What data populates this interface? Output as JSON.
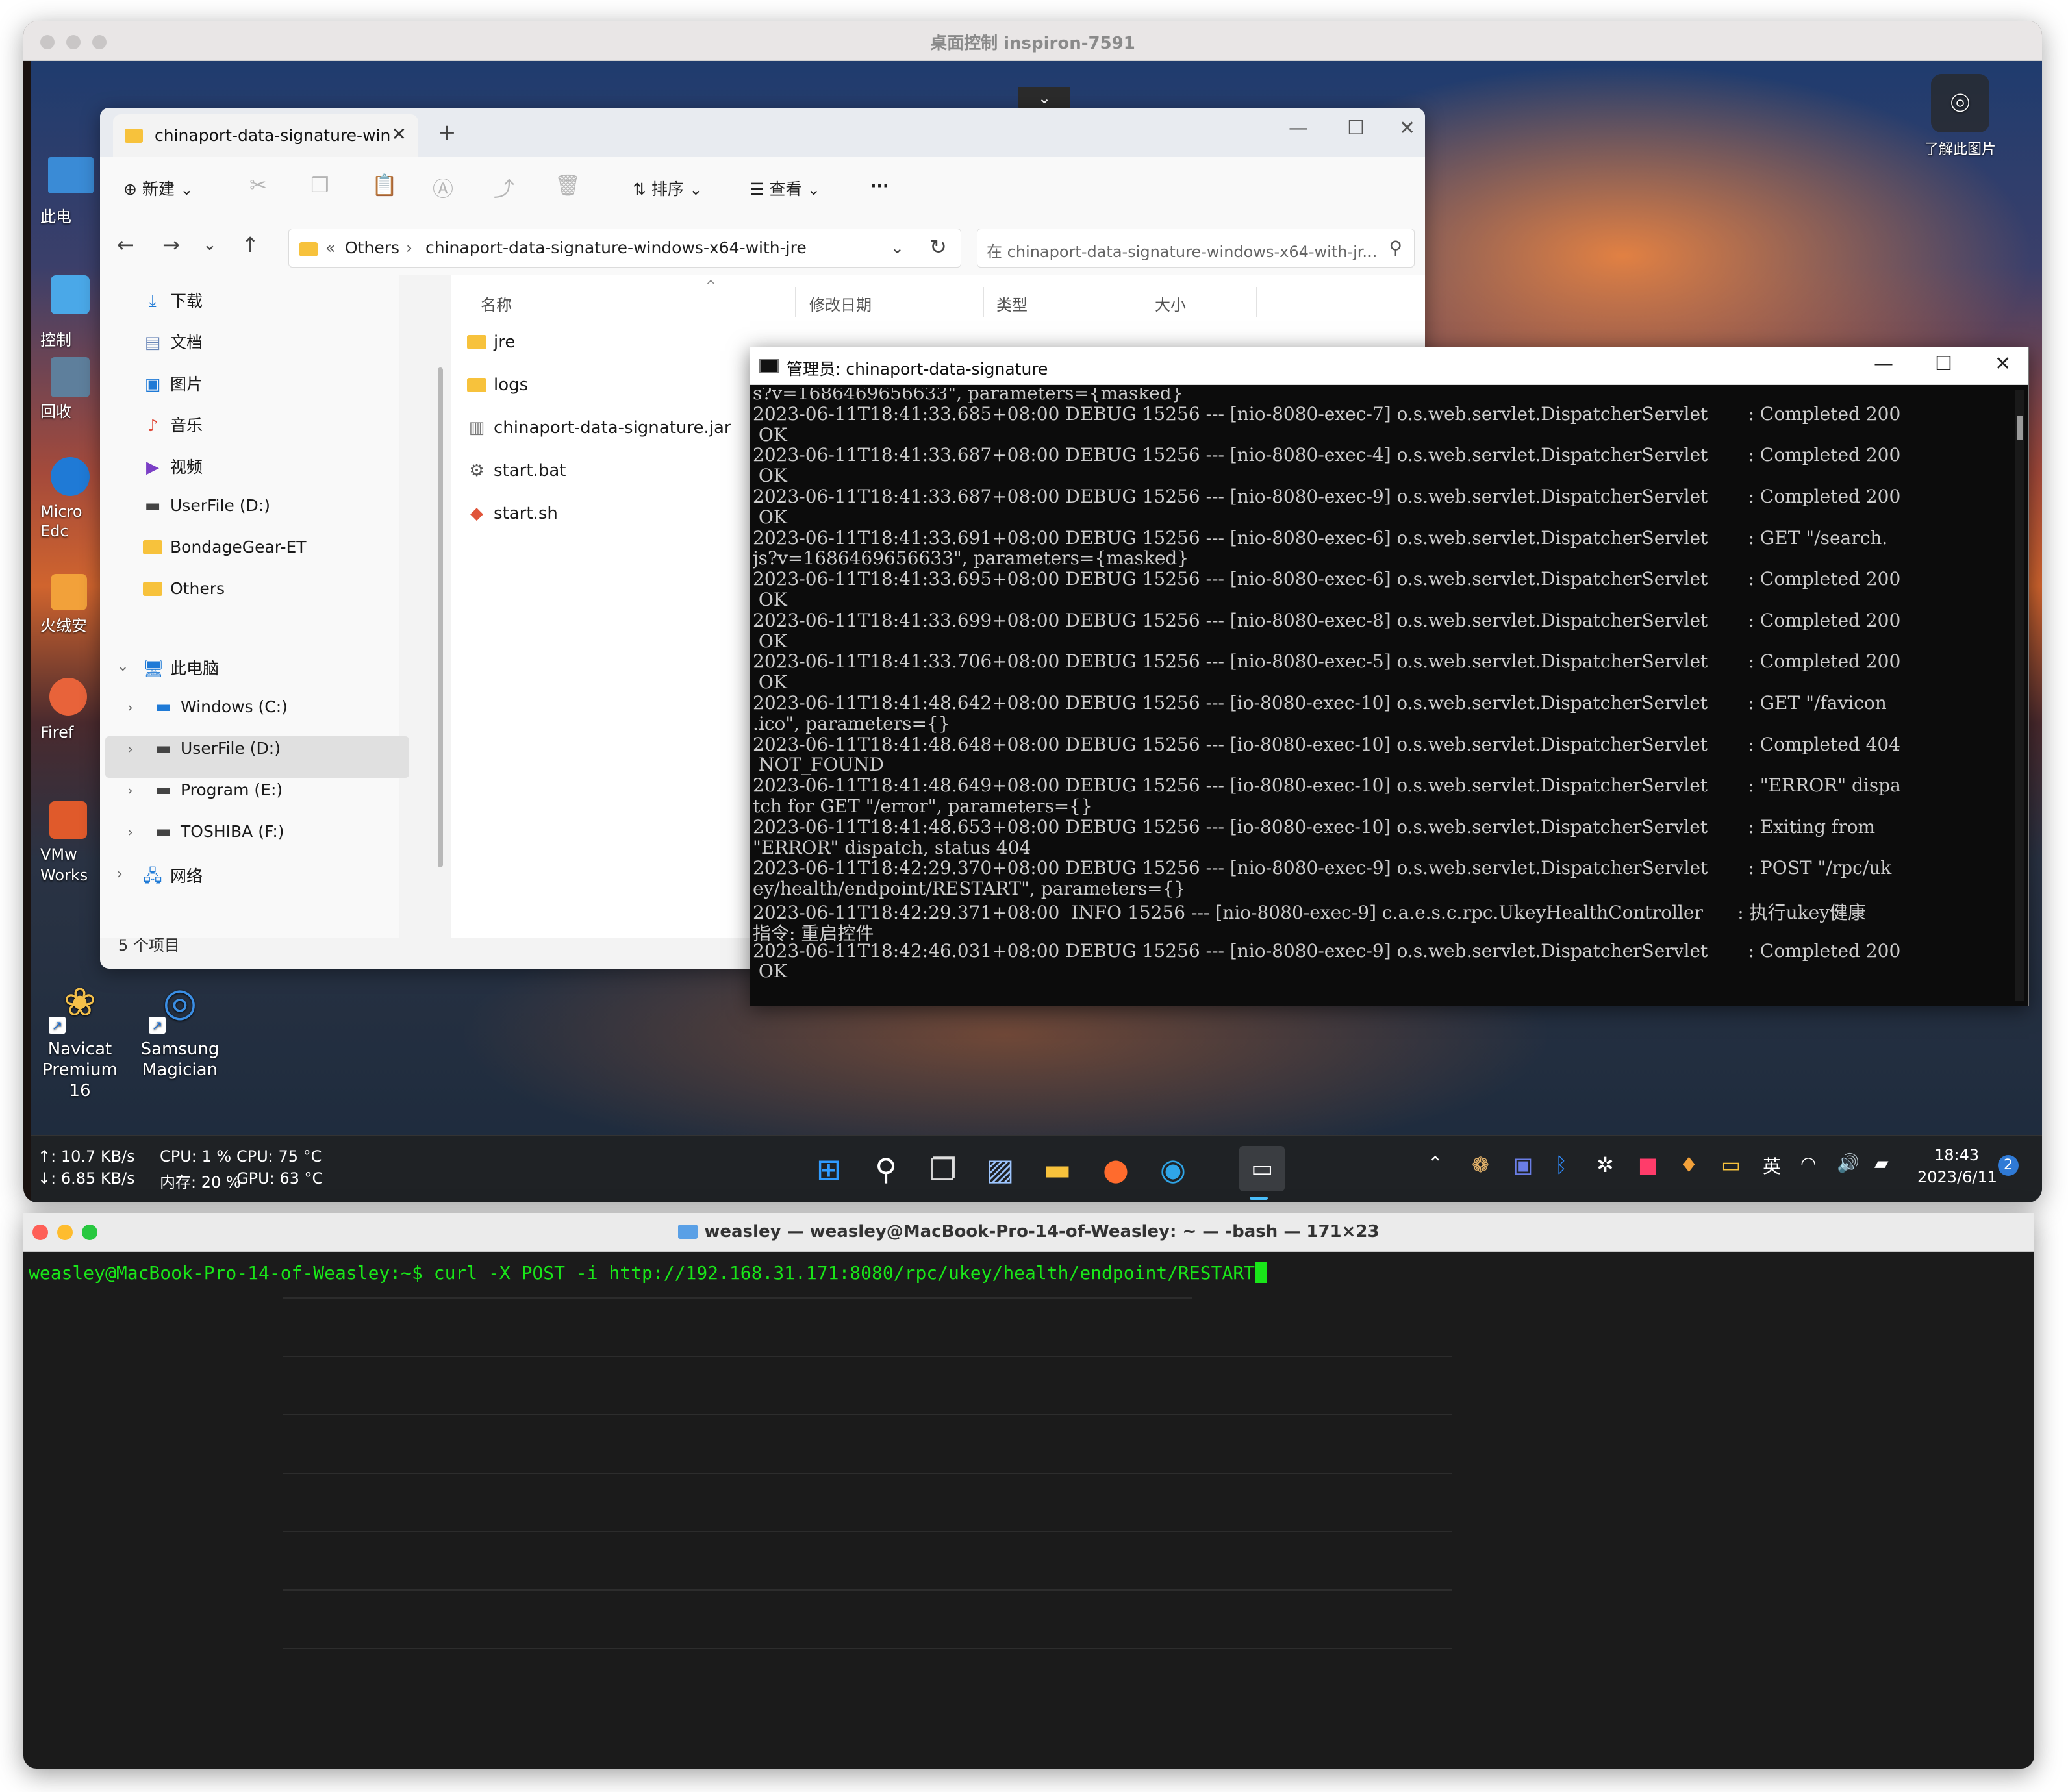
{
  "remote_window": {
    "title": "桌面控制 inspiron-7591"
  },
  "camera": {
    "label": "了解此图片"
  },
  "desktop_icons": [
    {
      "name": "navicat",
      "line1": "Navicat",
      "line2": "Premium 16"
    },
    {
      "name": "samsung",
      "line1": "Samsung",
      "line2": "Magician"
    }
  ],
  "desktop_edge_labels": [
    "此电",
    "控制",
    "回收",
    "Micro",
    "Edc",
    "火绒安",
    "Firef",
    "VMw",
    "Works"
  ],
  "explorer": {
    "tab_title": "chinaport-data-signature-win",
    "toolbar": {
      "new": "新建",
      "sort": "排序",
      "view": "查看",
      "more": "···"
    },
    "breadcrumb": {
      "root": "Others",
      "current": "chinaport-data-signature-windows-x64-with-jre"
    },
    "search_placeholder": "在 chinaport-data-signature-windows-x64-with-jr...",
    "nav": {
      "quick": [
        {
          "label": "下载",
          "icon": "download-icon"
        },
        {
          "label": "文档",
          "icon": "document-icon"
        },
        {
          "label": "图片",
          "icon": "picture-icon"
        },
        {
          "label": "音乐",
          "icon": "music-icon"
        },
        {
          "label": "视频",
          "icon": "video-icon"
        },
        {
          "label": "UserFile (D:)",
          "icon": "drive-icon"
        },
        {
          "label": "BondageGear-ET",
          "icon": "folder-icon"
        },
        {
          "label": "Others",
          "icon": "folder-icon"
        }
      ],
      "this_pc": "此电脑",
      "drives": [
        "Windows (C:)",
        "UserFile (D:)",
        "Program (E:)",
        "TOSHIBA (F:)"
      ],
      "network": "网络"
    },
    "columns": [
      "名称",
      "修改日期",
      "类型",
      "大小"
    ],
    "files": [
      "jre",
      "logs",
      "chinaport-data-signature.jar",
      "start.bat",
      "start.sh"
    ],
    "status": "5 个项目"
  },
  "console": {
    "title": "管理员: chinaport-data-signature",
    "lines": [
      "s?v=1686469656633\", parameters={masked}",
      "2023-06-11T18:41:33.685+08:00 DEBUG 15256 --- [nio-8080-exec-7] o.s.web.servlet.DispatcherServlet       : Completed 200",
      " OK",
      "2023-06-11T18:41:33.687+08:00 DEBUG 15256 --- [nio-8080-exec-4] o.s.web.servlet.DispatcherServlet       : Completed 200",
      " OK",
      "2023-06-11T18:41:33.687+08:00 DEBUG 15256 --- [nio-8080-exec-9] o.s.web.servlet.DispatcherServlet       : Completed 200",
      " OK",
      "2023-06-11T18:41:33.691+08:00 DEBUG 15256 --- [nio-8080-exec-6] o.s.web.servlet.DispatcherServlet       : GET \"/search.",
      "js?v=1686469656633\", parameters={masked}",
      "2023-06-11T18:41:33.695+08:00 DEBUG 15256 --- [nio-8080-exec-6] o.s.web.servlet.DispatcherServlet       : Completed 200",
      " OK",
      "2023-06-11T18:41:33.699+08:00 DEBUG 15256 --- [nio-8080-exec-8] o.s.web.servlet.DispatcherServlet       : Completed 200",
      " OK",
      "2023-06-11T18:41:33.706+08:00 DEBUG 15256 --- [nio-8080-exec-5] o.s.web.servlet.DispatcherServlet       : Completed 200",
      " OK",
      "2023-06-11T18:41:48.642+08:00 DEBUG 15256 --- [io-8080-exec-10] o.s.web.servlet.DispatcherServlet       : GET \"/favicon",
      ".ico\", parameters={}",
      "2023-06-11T18:41:48.648+08:00 DEBUG 15256 --- [io-8080-exec-10] o.s.web.servlet.DispatcherServlet       : Completed 404",
      " NOT_FOUND",
      "2023-06-11T18:41:48.649+08:00 DEBUG 15256 --- [io-8080-exec-10] o.s.web.servlet.DispatcherServlet       : \"ERROR\" dispa",
      "tch for GET \"/error\", parameters={}",
      "2023-06-11T18:41:48.653+08:00 DEBUG 15256 --- [io-8080-exec-10] o.s.web.servlet.DispatcherServlet       : Exiting from",
      "\"ERROR\" dispatch, status 404",
      "2023-06-11T18:42:29.370+08:00 DEBUG 15256 --- [nio-8080-exec-9] o.s.web.servlet.DispatcherServlet       : POST \"/rpc/uk",
      "ey/health/endpoint/RESTART\", parameters={}",
      "2023-06-11T18:42:29.371+08:00  INFO 15256 --- [nio-8080-exec-9] c.a.e.s.c.rpc.UkeyHealthController      : 执行ukey健康",
      "指令: 重启控件",
      "2023-06-11T18:42:46.031+08:00 DEBUG 15256 --- [nio-8080-exec-9] o.s.web.servlet.DispatcherServlet       : Completed 200",
      " OK"
    ]
  },
  "taskbar": {
    "net_up": "↑: 10.7 KB/s",
    "net_down": "↓: 6.85 KB/s",
    "cpu": "CPU: 1 %",
    "cpu_temp": "CPU: 75 °C",
    "mem": "内存: 20 %",
    "gpu_temp": "GPU: 63 °C",
    "ime": "英",
    "time": "18:43",
    "date": "2023/6/11",
    "badge": "2"
  },
  "terminal": {
    "title": "weasley — weasley@MacBook-Pro-14-of-Weasley: ~ — -bash — 171×23",
    "prompt": "weasley@MacBook-Pro-14-of-Weasley:~$ ",
    "command": "curl -X POST -i http://192.168.31.171:8080/rpc/ukey/health/endpoint/RESTART"
  },
  "colors": {
    "terminal_green": "#19e619",
    "taskbar": "#1f2225",
    "console_bg": "#0c0c0c",
    "folder": "#f7c23c"
  }
}
